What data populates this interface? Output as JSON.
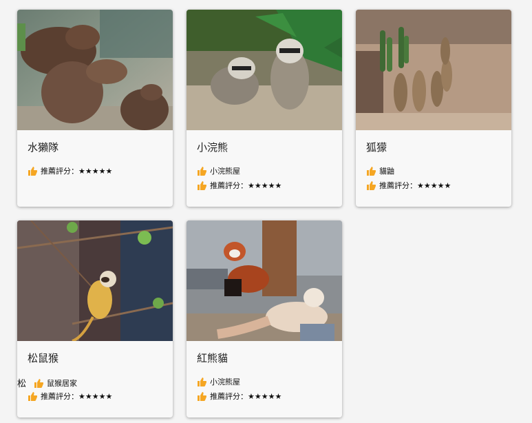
{
  "cards": [
    {
      "title": "水獺隊",
      "image": "otters-photo",
      "rows": [
        {
          "icon": "thumbs-up-icon",
          "label": "推薦評分：",
          "stars": "★★★★★"
        }
      ]
    },
    {
      "title": "小浣熊",
      "image": "raccoons-photo",
      "rows": [
        {
          "icon": "thumbs-up-icon",
          "label": "小浣熊屋"
        },
        {
          "icon": "thumbs-up-icon",
          "label": "推薦評分：",
          "stars": "★★★★★"
        }
      ]
    },
    {
      "title": "狐獴",
      "image": "meerkats-photo",
      "rows": [
        {
          "icon": "thumbs-up-icon",
          "label": "貓鼬"
        },
        {
          "icon": "thumbs-up-icon",
          "label": "推薦評分：",
          "stars": "★★★★★"
        }
      ]
    },
    {
      "title": "松鼠猴",
      "image": "squirrel-monkey-photo",
      "rows": [
        {
          "prefix": "松",
          "icon": "thumbs-up-icon",
          "label": "鼠猴居家"
        },
        {
          "icon": "thumbs-up-icon",
          "label": "推薦評分：",
          "stars": "★★★★★"
        }
      ]
    },
    {
      "title": "紅熊貓",
      "image": "red-panda-photo",
      "rows": [
        {
          "icon": "thumbs-up-icon",
          "label": "小浣熊屋"
        },
        {
          "icon": "thumbs-up-icon",
          "label": "推薦評分：",
          "stars": "★★★★★"
        }
      ]
    }
  ],
  "colors": {
    "thumb": "#f5a623",
    "card_bg": "#f8f8f8",
    "page_bg": "#f4f4f4"
  }
}
